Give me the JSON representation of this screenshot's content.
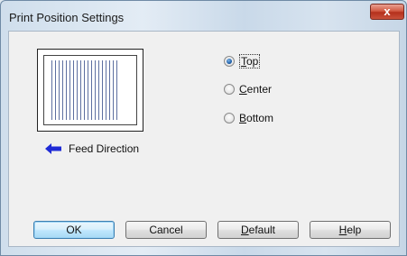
{
  "window": {
    "title": "Print Position Settings",
    "close_glyph": "x"
  },
  "feed": {
    "label": "Feed Direction",
    "arrow_icon": "left-arrow-icon",
    "arrow_color": "#1f2bd6"
  },
  "position": {
    "selected": "Top",
    "options": [
      {
        "prefix": "",
        "accel": "T",
        "rest": "op",
        "checked": true
      },
      {
        "prefix": "",
        "accel": "C",
        "rest": "enter",
        "checked": false
      },
      {
        "prefix": "",
        "accel": "B",
        "rest": "ottom",
        "checked": false
      }
    ]
  },
  "buttons": {
    "ok": "OK",
    "cancel": "Cancel",
    "default_accel": "D",
    "default_rest": "efault",
    "help_accel": "H",
    "help_rest": "elp"
  },
  "colors": {
    "accent": "#3c7fb1",
    "close": "#c9503a"
  }
}
